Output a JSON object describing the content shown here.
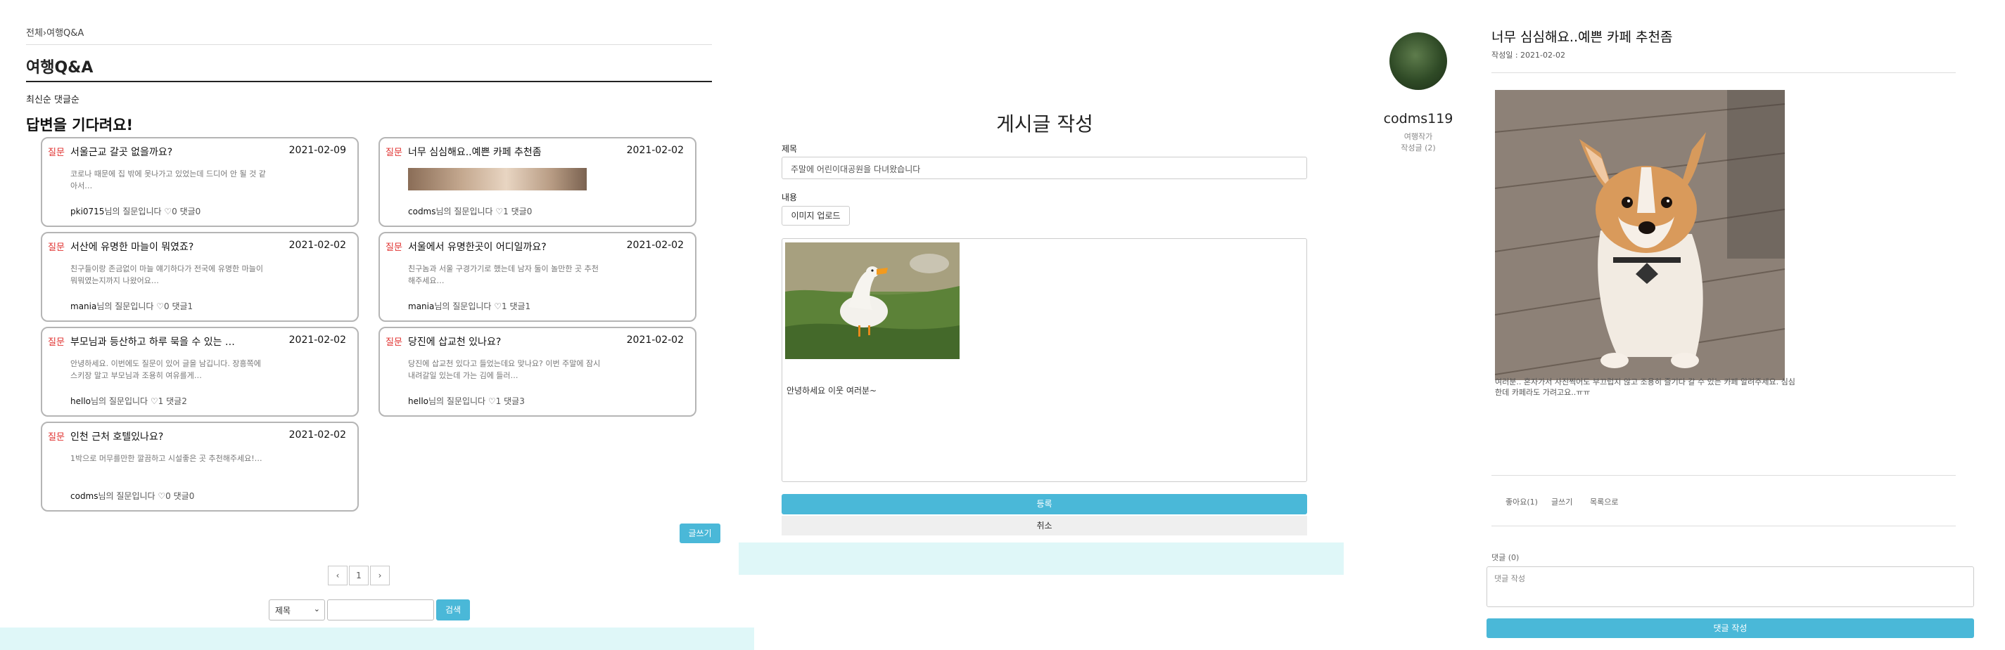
{
  "qna_list": {
    "breadcrumb": "전체›여행Q&A",
    "title": "여행Q&A",
    "sort_labels": "최신순 댓글순",
    "section_heading": "답변을 기다려요!",
    "cards": [
      {
        "tag": "질문",
        "title": "서울근교 갈곳 없을까요?",
        "date": "2021-02-09",
        "excerpt": "코로나 때문에 집 밖에 못나가고 있었는데 드디어 안 될 것 같아서…",
        "author": "pki0715",
        "meta_suffix": "님의 질문입니다 ♡0 댓글0"
      },
      {
        "tag": "질문",
        "title": "너무 심심해요..예쁜 카페 추천좀",
        "date": "2021-02-02",
        "excerpt": "",
        "author": "codms",
        "meta_suffix": "님의 질문입니다 ♡1 댓글0"
      },
      {
        "tag": "질문",
        "title": "서산에 유명한 마늘이 뭐였죠?",
        "date": "2021-02-02",
        "excerpt": "친구들이랑 존금없이 마늘 얘기하다가 전국에 유명한 마늘이 뭐뭐였는지까지 나왔어요…",
        "author": "mania",
        "meta_suffix": "님의 질문입니다 ♡0 댓글1"
      },
      {
        "tag": "질문",
        "title": "서울에서 유명한곳이 어디일까요?",
        "date": "2021-02-02",
        "excerpt": "친구놈과 서울 구경가기로 했는데 남자 둘이 놀만한 곳 추천해주세요…",
        "author": "mania",
        "meta_suffix": "님의 질문입니다 ♡1 댓글1"
      },
      {
        "tag": "질문",
        "title": "부모님과 등산하고 하루 묵을 수 있는 …",
        "date": "2021-02-02",
        "excerpt": "안녕하세요. 이번에도 질문이 있어 글을 남깁니다. 장흥쪽에 스키장 말고 부모님과 조용히 여유를게…",
        "author": "hello",
        "meta_suffix": "님의 질문입니다 ♡1 댓글2"
      },
      {
        "tag": "질문",
        "title": "당진에 삽교천 있나요?",
        "date": "2021-02-02",
        "excerpt": "당진에 삽교천 있다고 들었는데요 맞나요? 이번 주말에 잠시 내려갈일 있는데 가는 김에 들러…",
        "author": "hello",
        "meta_suffix": "님의 질문입니다 ♡1 댓글3"
      },
      {
        "tag": "질문",
        "title": "인천 근처 호텔있나요?",
        "date": "2021-02-02",
        "excerpt": "1박으로 머무를만한 깔끔하고 시설좋은 곳 추천해주세요!…",
        "author": "codms",
        "meta_suffix": "님의 질문입니다 ♡0 댓글0"
      }
    ],
    "write_button": "글쓰기",
    "pagination": {
      "prev": "‹",
      "current": "1",
      "next": "›"
    },
    "search": {
      "select_value": "제목",
      "select_caret": "⌄",
      "button": "검색"
    }
  },
  "write_post": {
    "header": "게시글 작성",
    "title_label": "제목",
    "title_value": "주말에 어린이대공원을 다녀왔습니다",
    "body_label": "내용",
    "upload_button": "이미지 업로드",
    "body_text": "안녕하세요 이웃 여러분~",
    "submit_button": "등록",
    "cancel_button": "취소"
  },
  "post_detail": {
    "username": "codms119",
    "role": "여행작가",
    "post_count": "작성글 (2)",
    "title": "너무 심심해요..예쁜 카페 추천좀",
    "date": "작성일 : 2021-02-02",
    "body": "여러분.. 혼자가서 사진찍어도 부끄럽지 않고 조용히 즐기다 갈 수 있는 카페 알려주세요. 심심한데 카페라도 가려고요..ㅠㅠ",
    "actions": {
      "like": "좋아요(1)",
      "write": "글쓰기",
      "list": "목록으로"
    },
    "comment_label": "댓글 (0)",
    "comment_placeholder": "댓글 작성",
    "comment_button": "댓글 작성"
  },
  "colors": {
    "accent": "#4ab8d8",
    "tag_red": "#e0312f",
    "footer_mint": "#dff7f8"
  }
}
